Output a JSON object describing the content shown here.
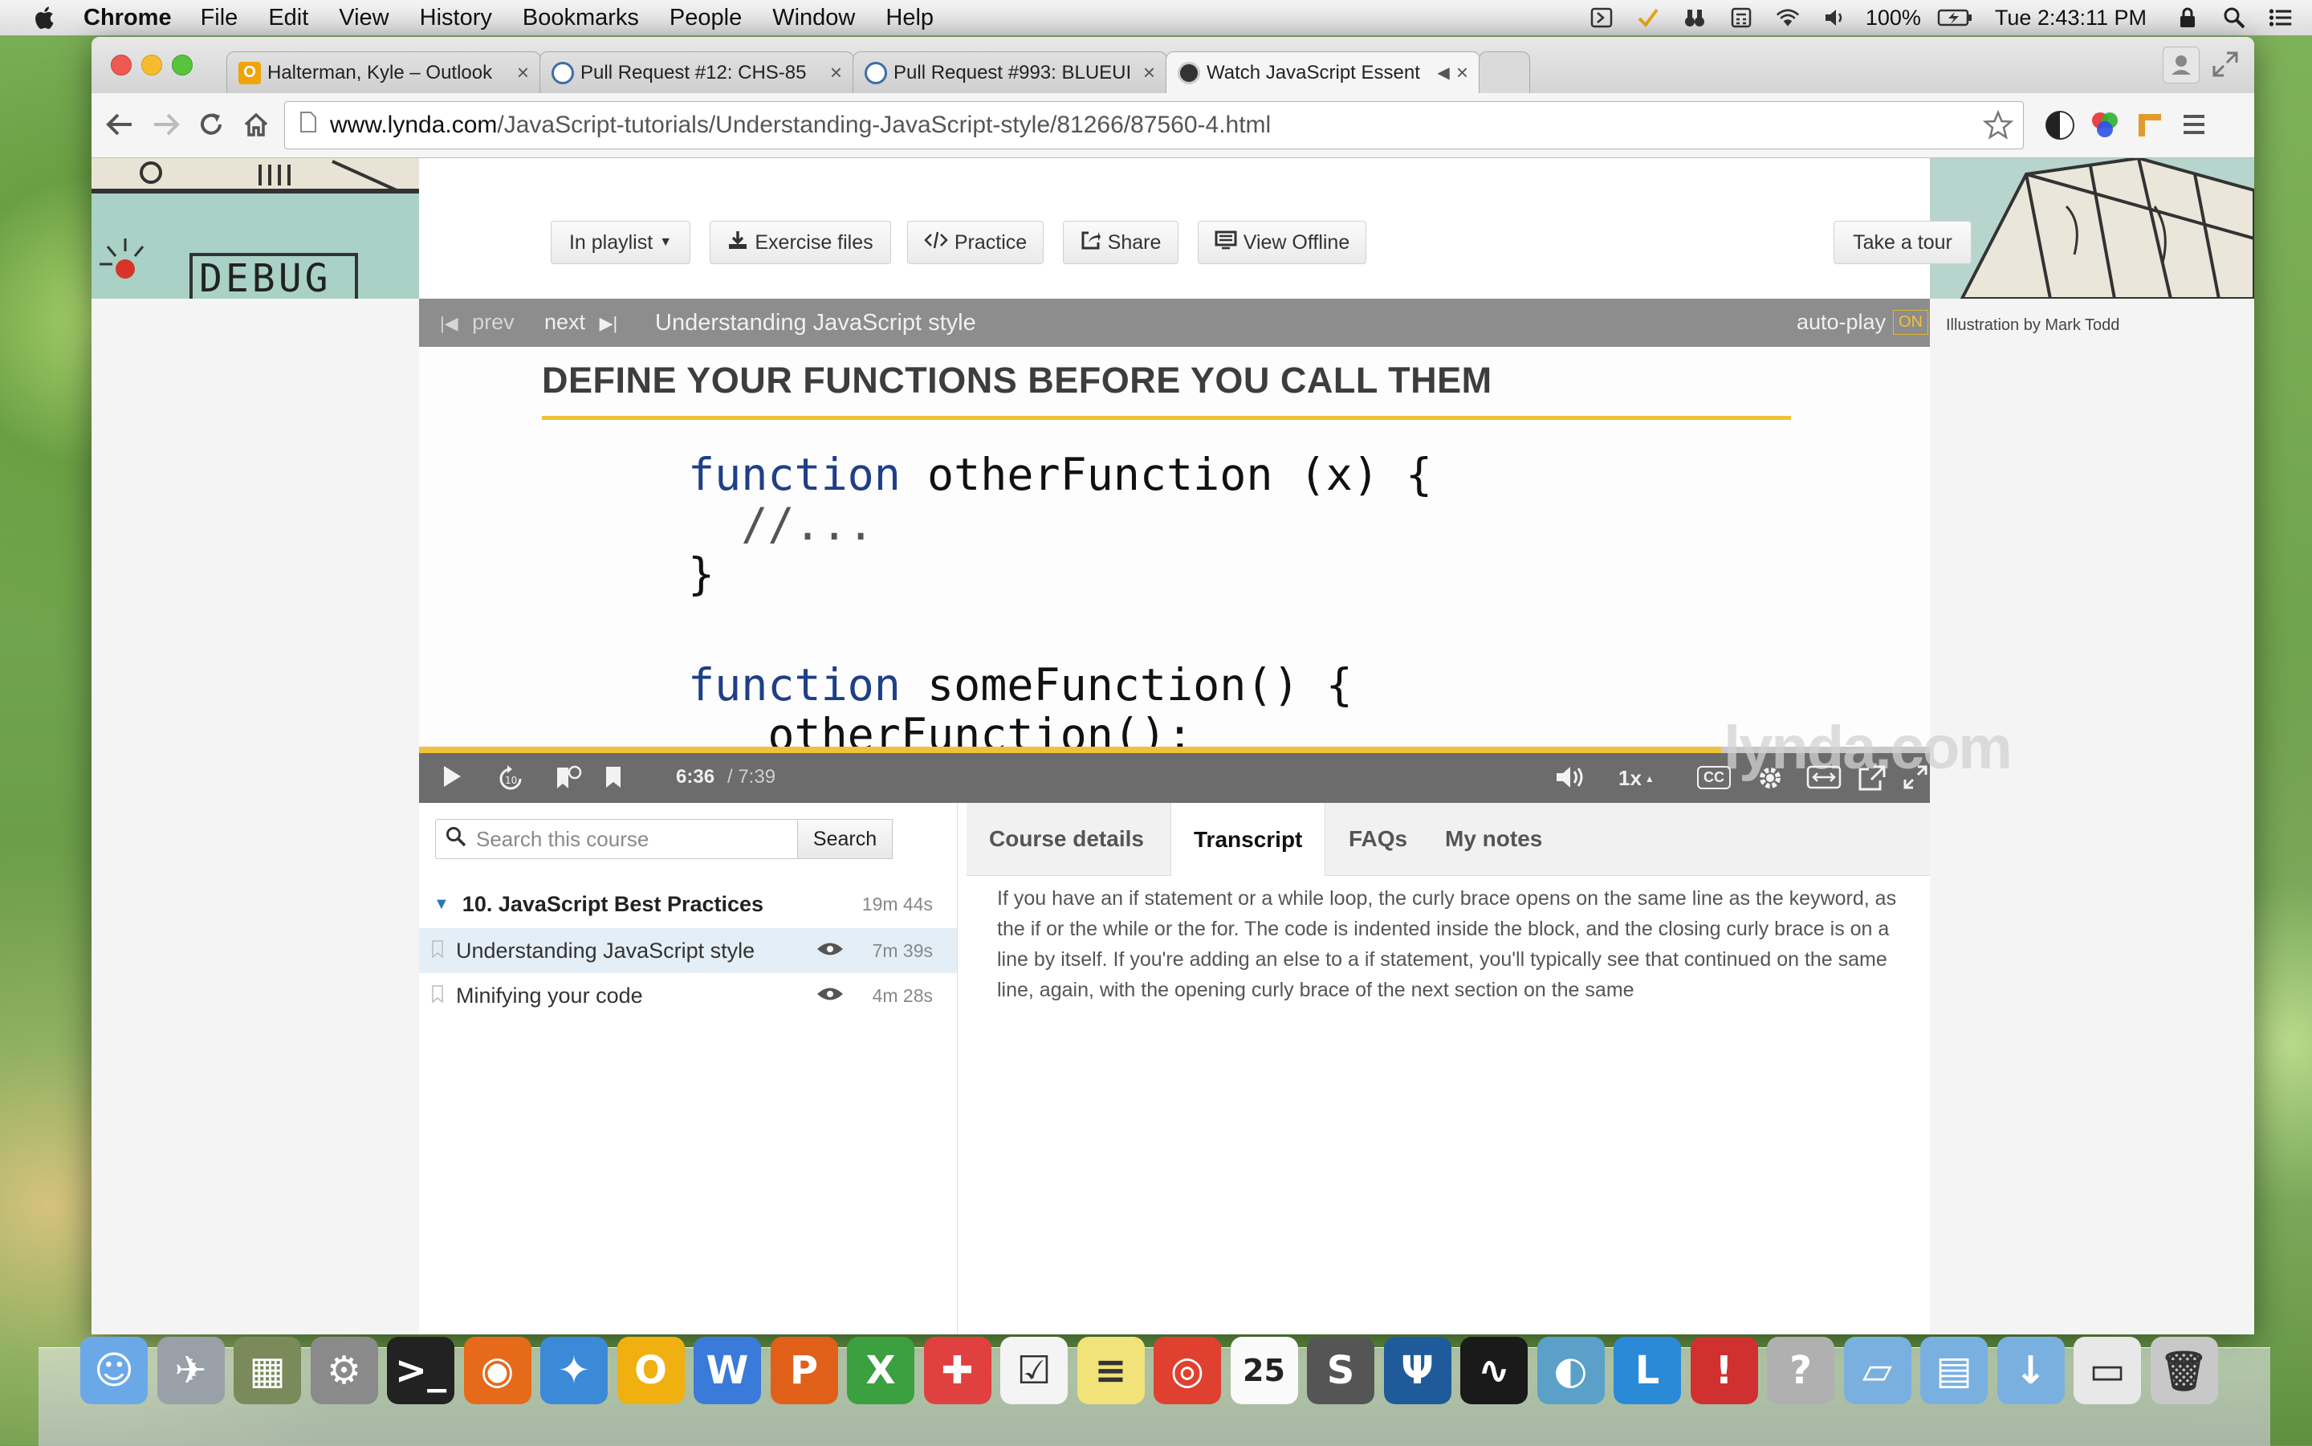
{
  "menubar": {
    "app": "Chrome",
    "items": [
      "File",
      "Edit",
      "View",
      "History",
      "Bookmarks",
      "People",
      "Window",
      "Help"
    ],
    "battery": "100%",
    "clock": "Tue 2:43:11 PM"
  },
  "tabs": [
    {
      "title": "Halterman, Kyle – Outlook",
      "icon": "outlook-icon"
    },
    {
      "title": "Pull Request #12: CHS-85",
      "icon": "github-icon"
    },
    {
      "title": "Pull Request #993: BLUEUI",
      "icon": "github-icon"
    },
    {
      "title": "Watch JavaScript Essent",
      "icon": "lynda-icon",
      "active": true
    }
  ],
  "url": {
    "host": "www.lynda.com",
    "path": "/JavaScript-tutorials/Understanding-JavaScript-style/81266/87560-4.html"
  },
  "header_buttons": {
    "playlist": "In playlist",
    "exercise": "Exercise files",
    "practice": "Practice",
    "share": "Share",
    "offline": "View Offline",
    "tour": "Take a tour"
  },
  "header_art": {
    "left_sign": "DEBUG"
  },
  "credit": "Illustration by Mark Todd",
  "player": {
    "prev": "prev",
    "next": "next",
    "title": "Understanding JavaScript style",
    "autoplay": "auto-play",
    "autoplay_state": "ON",
    "time_current": "6:36",
    "time_total": "/ 7:39",
    "speed": "1x",
    "cc": "CC",
    "progress": 0.862,
    "watermark": "lynda.com"
  },
  "slide": {
    "title": "DEFINE YOUR FUNCTIONS BEFORE YOU CALL THEM",
    "code1_line1_kw": "function",
    "code1_line1_rest": " otherFunction (x) {",
    "code1_line2": "  //...",
    "code1_line3": "}",
    "code2_line1_kw": "function",
    "code2_line1_rest": " someFunction() {",
    "code2_line2": "   otherFunction();",
    "code2_line3": "}"
  },
  "search": {
    "placeholder": "Search this course",
    "button": "Search"
  },
  "toc": {
    "chapter": "10. JavaScript Best Practices",
    "chapter_dur": "19m 44s",
    "items": [
      {
        "title": "Understanding JavaScript style",
        "dur": "7m 39s"
      },
      {
        "title": "Minifying your code",
        "dur": "4m 28s"
      }
    ]
  },
  "panel_tabs": [
    "Course details",
    "Transcript",
    "FAQs",
    "My notes"
  ],
  "transcript": "If you have an if statement or a while loop, the curly brace opens on the same line as the keyword, as the if or the while or the for. The code is indented inside the block, and the closing curly brace is on a line by itself. If you're adding an else to a if statement, you'll typically see that continued on the same line, again, with the opening curly brace of the next section on the same",
  "dock_icons": [
    "finder-icon",
    "launchpad-icon",
    "preview-icon",
    "system-preferences-icon",
    "terminal-icon",
    "firefox-icon",
    "safari-icon",
    "outlook-icon",
    "word-icon",
    "powerpoint-icon",
    "excel-icon",
    "crossover-icon",
    "reminders-icon",
    "stickies-icon",
    "chrome-icon",
    "calendar-icon",
    "sublime-icon",
    "sourcetree-icon",
    "activity-monitor-icon",
    "network-icon",
    "lync-icon",
    "instruments-icon",
    "help-icon",
    "folder-icon",
    "documents-icon",
    "downloads-icon",
    "stack-icon",
    "trash-icon"
  ],
  "dock_calendar_day": "25"
}
